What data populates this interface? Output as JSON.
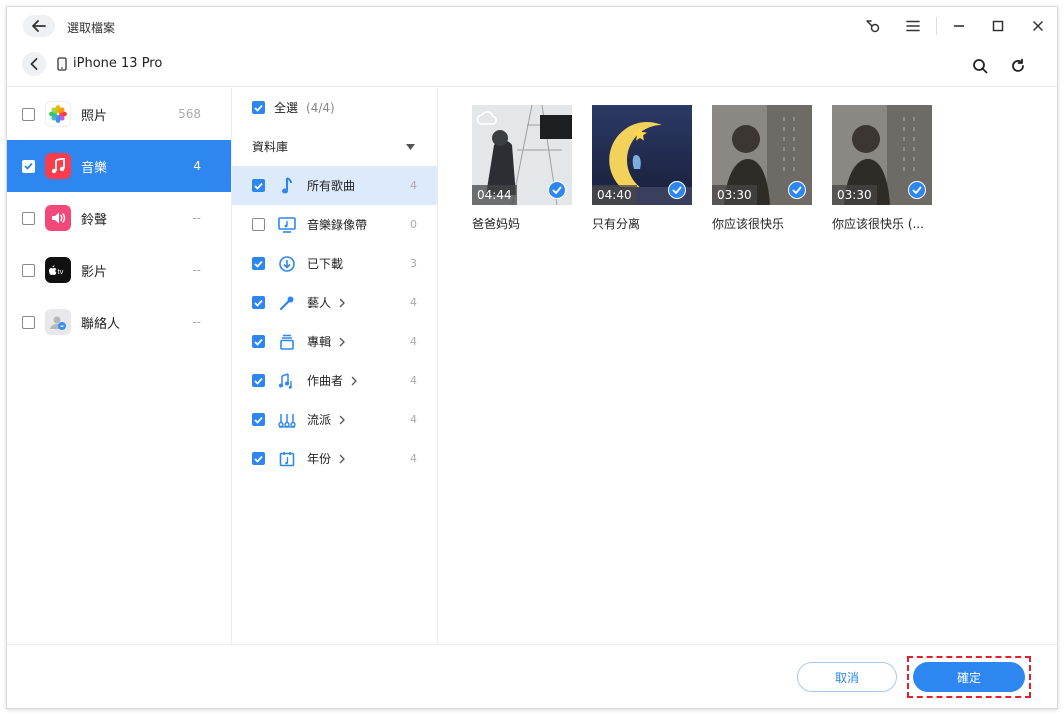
{
  "window": {
    "title": "選取檔案",
    "device_name": "iPhone 13 Pro"
  },
  "sidebar": {
    "items": [
      {
        "label": "照片",
        "count": "568",
        "checked": false,
        "active": false,
        "icon": "photos-icon"
      },
      {
        "label": "音樂",
        "count": "4",
        "checked": true,
        "active": true,
        "icon": "music-app-icon"
      },
      {
        "label": "鈴聲",
        "count": "--",
        "checked": false,
        "active": false,
        "icon": "ringtone-icon"
      },
      {
        "label": "影片",
        "count": "--",
        "checked": false,
        "active": false,
        "icon": "apple-tv-icon"
      },
      {
        "label": "聯絡人",
        "count": "--",
        "checked": false,
        "active": false,
        "icon": "contacts-icon"
      }
    ]
  },
  "middle": {
    "select_all_label": "全選",
    "select_all_count": "(4/4)",
    "library_label": "資料庫",
    "rows": [
      {
        "label": "所有歌曲",
        "count": "4",
        "checked": true,
        "selected": true,
        "chevron": false,
        "icon": "music-note-icon"
      },
      {
        "label": "音樂錄像帶",
        "count": "0",
        "checked": false,
        "selected": false,
        "chevron": false,
        "icon": "music-video-icon"
      },
      {
        "label": "已下載",
        "count": "3",
        "checked": true,
        "selected": false,
        "chevron": false,
        "icon": "download-icon"
      },
      {
        "label": "藝人",
        "count": "4",
        "checked": true,
        "selected": false,
        "chevron": true,
        "icon": "microphone-icon"
      },
      {
        "label": "專輯",
        "count": "4",
        "checked": true,
        "selected": false,
        "chevron": true,
        "icon": "album-icon"
      },
      {
        "label": "作曲者",
        "count": "4",
        "checked": true,
        "selected": false,
        "chevron": true,
        "icon": "composer-icon"
      },
      {
        "label": "流派",
        "count": "4",
        "checked": true,
        "selected": false,
        "chevron": true,
        "icon": "genre-icon"
      },
      {
        "label": "年份",
        "count": "4",
        "checked": true,
        "selected": false,
        "chevron": true,
        "icon": "calendar-icon"
      }
    ]
  },
  "songs": [
    {
      "title": "爸爸妈妈",
      "duration": "04:44",
      "checked": true,
      "cover": "cover-1"
    },
    {
      "title": "只有分离",
      "duration": "04:40",
      "checked": true,
      "cover": "cover-2"
    },
    {
      "title": "你应该很快乐",
      "duration": "03:30",
      "checked": true,
      "cover": "cover-3"
    },
    {
      "title": "你应该很快乐 (...",
      "duration": "03:30",
      "checked": true,
      "cover": "cover-3"
    }
  ],
  "footer": {
    "cancel_label": "取消",
    "confirm_label": "確定"
  },
  "colors": {
    "accent": "#2e87f0",
    "highlight_border": "#e0202a"
  }
}
